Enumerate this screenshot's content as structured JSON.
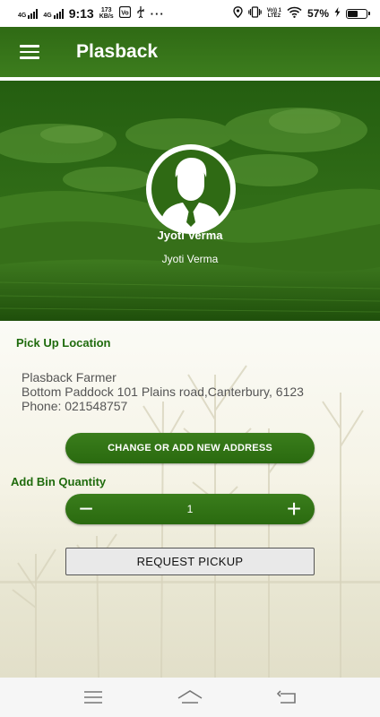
{
  "status_bar": {
    "network1": "4G",
    "network2": "4G",
    "time": "9:13",
    "speed_value": "173",
    "speed_unit": "KB/s",
    "volte_top": "Vo)) 1",
    "volte_bottom": "LTE2",
    "battery_percent": "57%",
    "battery_level": 0.57
  },
  "app_bar": {
    "title": "Plasback"
  },
  "profile": {
    "name": "Jyoti Verma",
    "subtitle": "Jyoti Verma"
  },
  "pickup": {
    "section_title": "Pick Up Location",
    "address_line1": "Plasback Farmer",
    "address_line2": "Bottom Paddock 101 Plains road,Canterbury, 6123",
    "address_line3": "Phone: 021548757",
    "change_address_label": "CHANGE OR ADD NEW ADDRESS"
  },
  "bin": {
    "section_title": "Add Bin Quantity",
    "minus_symbol": "−",
    "plus_symbol": "+",
    "quantity": "1"
  },
  "request_pickup_label": "REQUEST PICKUP",
  "colors": {
    "brand_green": "#2f6a14",
    "label_green": "#1f6b0d"
  },
  "icons": {
    "menu": "hamburger-menu-icon",
    "avatar": "user-avatar-icon",
    "nav_recents": "recents-icon",
    "nav_home": "home-icon",
    "nav_back": "back-icon"
  }
}
